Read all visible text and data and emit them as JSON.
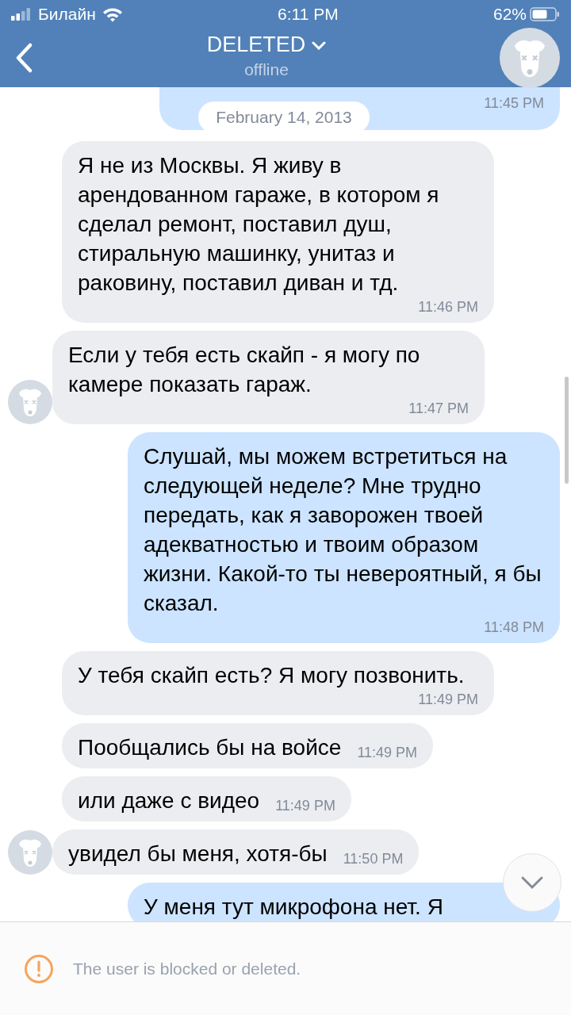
{
  "status_bar": {
    "carrier": "Билайн",
    "time": "6:11 PM",
    "battery": "62%"
  },
  "header": {
    "title": "DELETED",
    "subtitle": "offline"
  },
  "messages": [
    {
      "kind": "outgoing",
      "time": "11:45 PM"
    },
    {
      "kind": "date",
      "text": "February 14, 2013"
    },
    {
      "kind": "incoming",
      "text": "Я не из Москвы. Я живу в арендованном гараже, в котором я сделал ремонт, поставил душ, стиральную машинку, унитаз и раковину, поставил диван и тд.",
      "time": "11:46 PM",
      "avatar": false
    },
    {
      "kind": "incoming",
      "text": "Если у тебя есть скайп - я могу по камере показать гараж.",
      "time": "11:47 PM",
      "avatar": true
    },
    {
      "kind": "outgoing",
      "text": "Слушай, мы можем встретиться на следующей неделе? Мне трудно передать, как я заворожен твоей адекватностью и твоим образом жизни. Какой-то ты невероятный, я бы сказал.",
      "time": "11:48 PM"
    },
    {
      "kind": "incoming",
      "text": "У тебя скайп есть? Я могу позвонить.",
      "time": "11:49 PM",
      "avatar": false
    },
    {
      "kind": "incoming",
      "text": "Пообщались бы на войсе",
      "time": "11:49 PM",
      "avatar": false
    },
    {
      "kind": "incoming",
      "text": "или даже с видео",
      "time": "11:49 PM",
      "avatar": false
    },
    {
      "kind": "incoming",
      "text": "увидел бы меня, хотя-бы",
      "time": "11:50 PM",
      "avatar": true
    },
    {
      "kind": "outgoing",
      "text": "У меня тут микрофона нет. Я"
    }
  ],
  "footer": {
    "notice": "The user is blocked or deleted."
  }
}
